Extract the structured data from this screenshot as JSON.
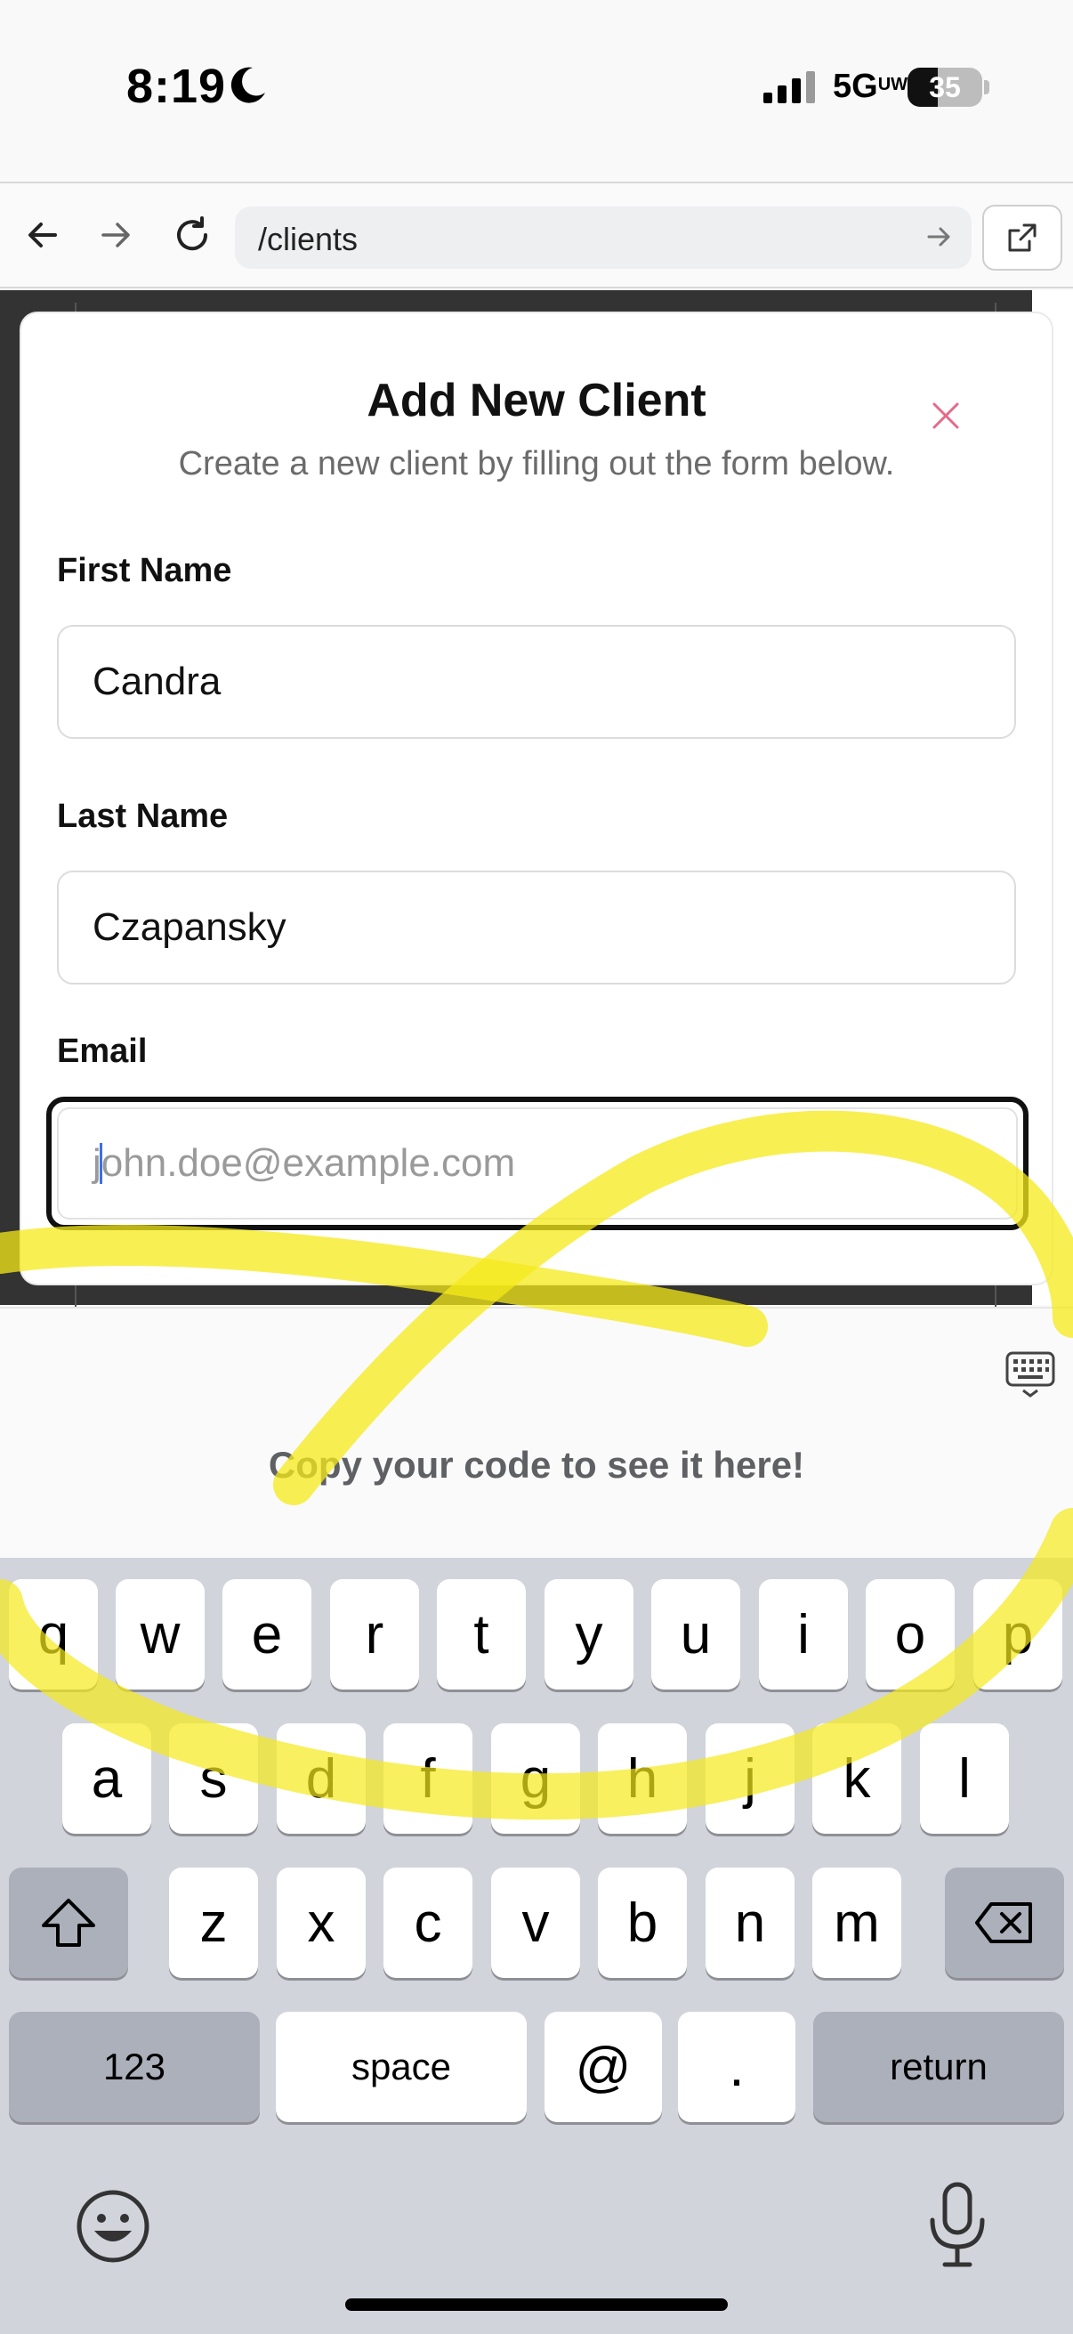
{
  "status_bar": {
    "time": "8:19",
    "network": "5G",
    "network_suffix": "UW",
    "battery": "35",
    "icons": [
      "moon-icon",
      "signal-icon",
      "battery-icon"
    ]
  },
  "browser": {
    "url": "/clients",
    "icons": [
      "back-arrow-icon",
      "forward-arrow-icon",
      "reload-icon",
      "go-arrow-icon",
      "external-link-icon"
    ]
  },
  "modal": {
    "title": "Add New Client",
    "subtitle": "Create a new client by filling out the form below.",
    "close_icon": "close-icon",
    "fields": [
      {
        "label": "First Name",
        "value": "Candra",
        "placeholder": ""
      },
      {
        "label": "Last Name",
        "value": "Czapansky",
        "placeholder": ""
      },
      {
        "label": "Email",
        "value": "",
        "placeholder": "john.doe@example.com"
      }
    ]
  },
  "code_panel": {
    "message": "Copy your code to see it here!",
    "icon": "keyboard-icon"
  },
  "keyboard": {
    "row1": [
      "q",
      "w",
      "e",
      "r",
      "t",
      "y",
      "u",
      "i",
      "o",
      "p"
    ],
    "row2": [
      "a",
      "s",
      "d",
      "f",
      "g",
      "h",
      "j",
      "k",
      "l"
    ],
    "row3": [
      "z",
      "x",
      "c",
      "v",
      "b",
      "n",
      "m"
    ],
    "numbers_label": "123",
    "space_label": "space",
    "at_label": "@",
    "period_label": ".",
    "return_label": "return",
    "icons": [
      "shift-icon",
      "backspace-icon",
      "emoji-icon",
      "microphone-icon"
    ]
  },
  "colors": {
    "accent_close": "#e46a8a",
    "caret": "#3b6fe8",
    "scribble": "#f5ea1a",
    "keyboard_bg": "#d1d4db"
  }
}
